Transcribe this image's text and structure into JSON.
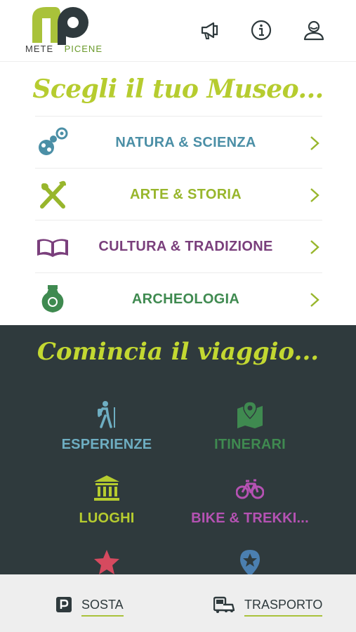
{
  "header": {
    "logo_left": "METE",
    "logo_right": "PICENE",
    "icons": [
      "megaphone-icon",
      "info-icon",
      "user-icon"
    ]
  },
  "museo": {
    "title": "Scegli il tuo Museo...",
    "items": [
      {
        "label": "NATURA & SCIENZA",
        "icon": "nature-science-icon",
        "color": "#4b8fa6"
      },
      {
        "label": "ARTE & STORIA",
        "icon": "art-brush-icon",
        "color": "#98b62c"
      },
      {
        "label": "CULTURA & TRADIZIONE",
        "icon": "book-icon",
        "color": "#7a3f7c"
      },
      {
        "label": "ARCHEOLOGIA",
        "icon": "vase-icon",
        "color": "#3f8a50"
      }
    ],
    "chevron_color": "#98b62c"
  },
  "viaggio": {
    "title": "Comincia il viaggio...",
    "tiles": [
      {
        "label": "ESPERIENZE",
        "icon": "hiker-icon",
        "color": "#6eaec2"
      },
      {
        "label": "ITINERARI",
        "icon": "map-pin-icon",
        "color": "#3f8a50"
      },
      {
        "label": "LUOGHI",
        "icon": "building-icon",
        "color": "#b6cc2f"
      },
      {
        "label": "BIKE & TREKKI...",
        "icon": "bike-icon",
        "color": "#b552b3"
      },
      {
        "label": "",
        "icon": "star-icon",
        "color": "#d64a5f"
      },
      {
        "label": "",
        "icon": "star-location-icon",
        "color": "#4b7fb0"
      }
    ]
  },
  "bottom_bar": {
    "sosta": "SOSTA",
    "trasporto": "TRASPORTO"
  }
}
